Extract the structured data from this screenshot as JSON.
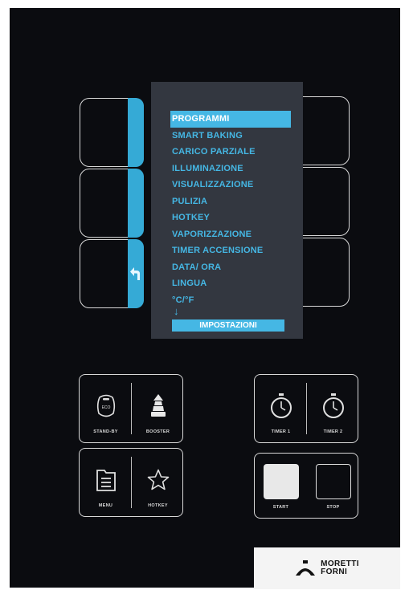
{
  "display": {
    "menu_items": [
      "PROGRAMMI",
      "SMART BAKING",
      "CARICO PARZIALE",
      "ILLUMINAZIONE",
      "VISUALIZZAZIONE",
      "PULIZIA",
      "HOTKEY",
      "VAPORIZZAZIONE",
      "TIMER ACCENSIONE",
      "DATA/ ORA",
      "LINGUA",
      "°C/°F"
    ],
    "selected_index": 0,
    "title": "IMPOSTAZIONI"
  },
  "controls": {
    "standby": "STAND-BY",
    "eco": "ECO",
    "booster": "BOOSTER",
    "timer1": "TIMER 1",
    "timer2": "TIMER 2",
    "menu": "MENU",
    "hotkey": "HOTKEY",
    "start": "START",
    "stop": "STOP"
  },
  "brand": {
    "line1": "MORETTI",
    "line2": "FORNI"
  },
  "colors": {
    "panel": "#0b0c10",
    "accent": "#45b7e4",
    "display_bg": "#333740",
    "outline": "#d9d9d9"
  }
}
